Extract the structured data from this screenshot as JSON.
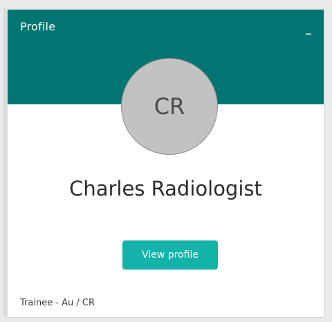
{
  "profile": {
    "title": "Profile",
    "collapse_label": "–",
    "initials": "CR",
    "name": "Charles Radiologist",
    "view_button_label": "View profile",
    "role": "Trainee - Au / CR"
  },
  "colors": {
    "banner": "#007571",
    "button": "#13b3aa",
    "avatar": "#c2c2c2"
  }
}
